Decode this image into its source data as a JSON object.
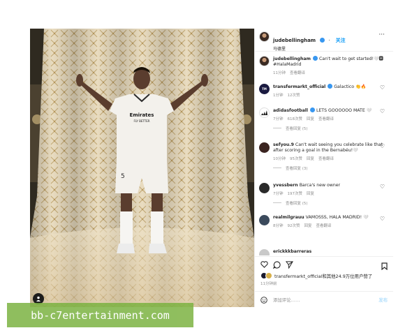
{
  "post": {
    "username": "judebellingham",
    "follow_label": "关注",
    "location": "马德里",
    "more": "···"
  },
  "comments": [
    {
      "user": "judebellingham",
      "text": "Can't wait to get started!🤍🅼 #HalaMadrid",
      "time": "11分钟",
      "likes": "",
      "reply": "",
      "translate": "查看翻译",
      "replies": "",
      "avatar_color": "#6b4a3a"
    },
    {
      "user": "transfermarkt_official",
      "text": "Galactico 👏🔥",
      "time": "1分钟",
      "likes": "12次赞",
      "reply": "",
      "translate": "",
      "replies": "",
      "avatar_color": "#1a1a40"
    },
    {
      "user": "adidasfootball",
      "text": "LETS GOOOOOO MATE 🤍",
      "time": "7分钟",
      "likes": "618次赞",
      "reply": "回复",
      "translate": "查看翻译",
      "replies": "查看回复 (5)",
      "avatar_color": "#ffffff"
    },
    {
      "user": "sefyou.9",
      "text": "Can't wait seeing you celebrate like that after scoring a goal in the Bernabéu!🤍",
      "time": "10分钟",
      "likes": "95次赞",
      "reply": "回复",
      "translate": "查看翻译",
      "replies": "查看回复 (3)",
      "avatar_color": "#3a2420"
    },
    {
      "user": "yvessbern",
      "text": "Barca's new owner",
      "time": "7分钟",
      "likes": "197次赞",
      "reply": "回复",
      "translate": "",
      "replies": "查看回复 (5)",
      "avatar_color": "#2a2a2a"
    },
    {
      "user": "realmilgrauu",
      "text": "VAMOSSS, HALA MADRID! 🤍",
      "time": "8分钟",
      "likes": "92次赞",
      "reply": "回复",
      "translate": "查看翻译",
      "replies": "",
      "avatar_color": "#3b4a5c"
    },
    {
      "user": "erickkkbarreras",
      "text": "",
      "time": "",
      "likes": "",
      "reply": "",
      "translate": "",
      "replies": "",
      "avatar_color": "#c9c9c9"
    }
  ],
  "likes_line": "transfermarkt_official和其他24.9万位用户赞了",
  "post_age": "11分钟前",
  "add_comment_placeholder": "添加评论……",
  "post_button": "发布",
  "watermark": "bb-c7entertainment.com",
  "colors": {
    "accent_blue": "#0095f6",
    "verified_blue": "#3897f0",
    "muted": "#8e8e8e",
    "watermark_green": "#7cb342"
  },
  "icons": {
    "like": "heart-icon",
    "comment": "comment-icon",
    "share": "share-icon",
    "save": "bookmark-icon",
    "emoji": "emoji-icon",
    "more": "more-icon"
  }
}
